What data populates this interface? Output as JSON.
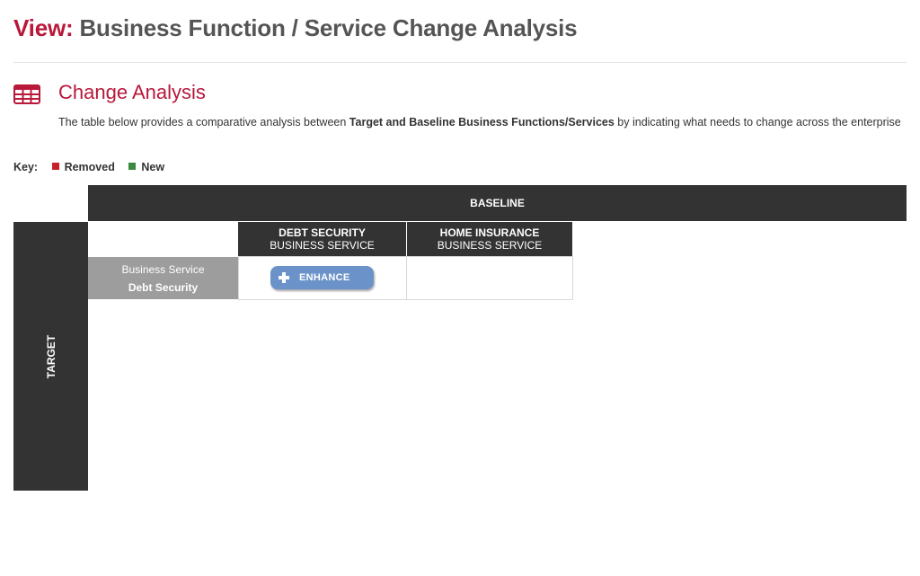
{
  "header": {
    "view_prefix": "View:",
    "view_title": "Business Function / Service Change Analysis"
  },
  "section": {
    "icon": "table-icon",
    "title": "Change Analysis",
    "description_1": "The table below provides a comparative analysis between ",
    "description_bold": "Target and Baseline  Business Functions/Services",
    "description_2": " by indicating what needs to change across  the enterprise"
  },
  "key": {
    "label": "Key:",
    "items": [
      {
        "label": "Removed",
        "color": "#c8202a"
      },
      {
        "label": "New",
        "color": "#3a8a3f"
      }
    ]
  },
  "matrix": {
    "baseline_label": "BASELINE",
    "target_label": "TARGET",
    "columns": [
      {
        "name": "DEBT SECURITY",
        "type": "BUSINESS SERVICE"
      },
      {
        "name": "HOME INSURANCE",
        "type": "BUSINESS SERVICE"
      }
    ],
    "rows": [
      {
        "type": "Business Service",
        "name": "Debt Security"
      }
    ],
    "actions": {
      "enhance_label": "ENHANCE",
      "enhance_icon": "plus-icon",
      "enhance_color": "#6b93c9"
    }
  },
  "colors": {
    "accent": "#b8183a",
    "dark_header": "#333333",
    "row_header": "#9d9d9d"
  }
}
